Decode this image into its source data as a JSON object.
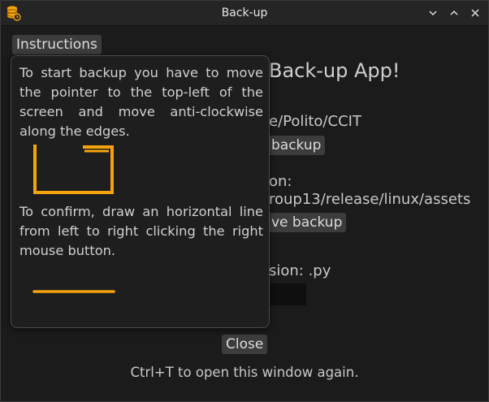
{
  "window": {
    "title": "Back-up",
    "controls": [
      "minimize",
      "maximize",
      "close"
    ]
  },
  "background": {
    "title": "Back-up App!",
    "source_path": "e/Polito/CCIT",
    "source_button": "backup",
    "dest_label": "on:",
    "dest_path": "roup13/release/linux/assets",
    "dest_button": "ve backup",
    "extension_label": "sion: .py"
  },
  "instructions_button": "Instructions",
  "popup": {
    "text1": "To start backup you have to move the pointer to the top-left of the screen and move anti-clockwise along the edges.",
    "text2": "To confirm, draw an horizontal line from left to right clicking the right mouse button."
  },
  "close_button": "Close",
  "footer": "Ctrl+T to open this window again.",
  "colors": {
    "accent": "#f5a30c",
    "background": "#1b1b1b",
    "button": "#3c3c3c"
  }
}
